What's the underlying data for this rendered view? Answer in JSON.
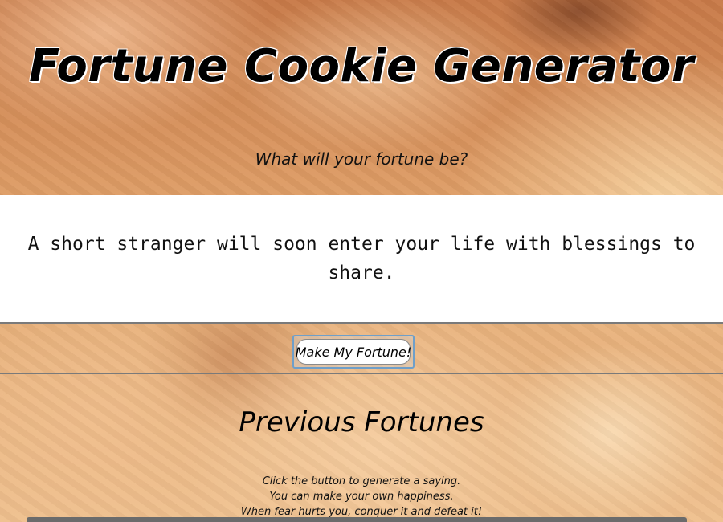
{
  "header": {
    "title": "Fortune Cookie Generator",
    "subtitle": "What will your fortune be?"
  },
  "fortune": {
    "current": "A short stranger will soon enter your life with blessings to share."
  },
  "button": {
    "label": "Make My Fortune!"
  },
  "previous": {
    "heading": "Previous Fortunes",
    "items": [
      "Click the button to generate a saying.",
      "You can make your own happiness.",
      "When fear hurts you, conquer it and defeat it!"
    ]
  }
}
